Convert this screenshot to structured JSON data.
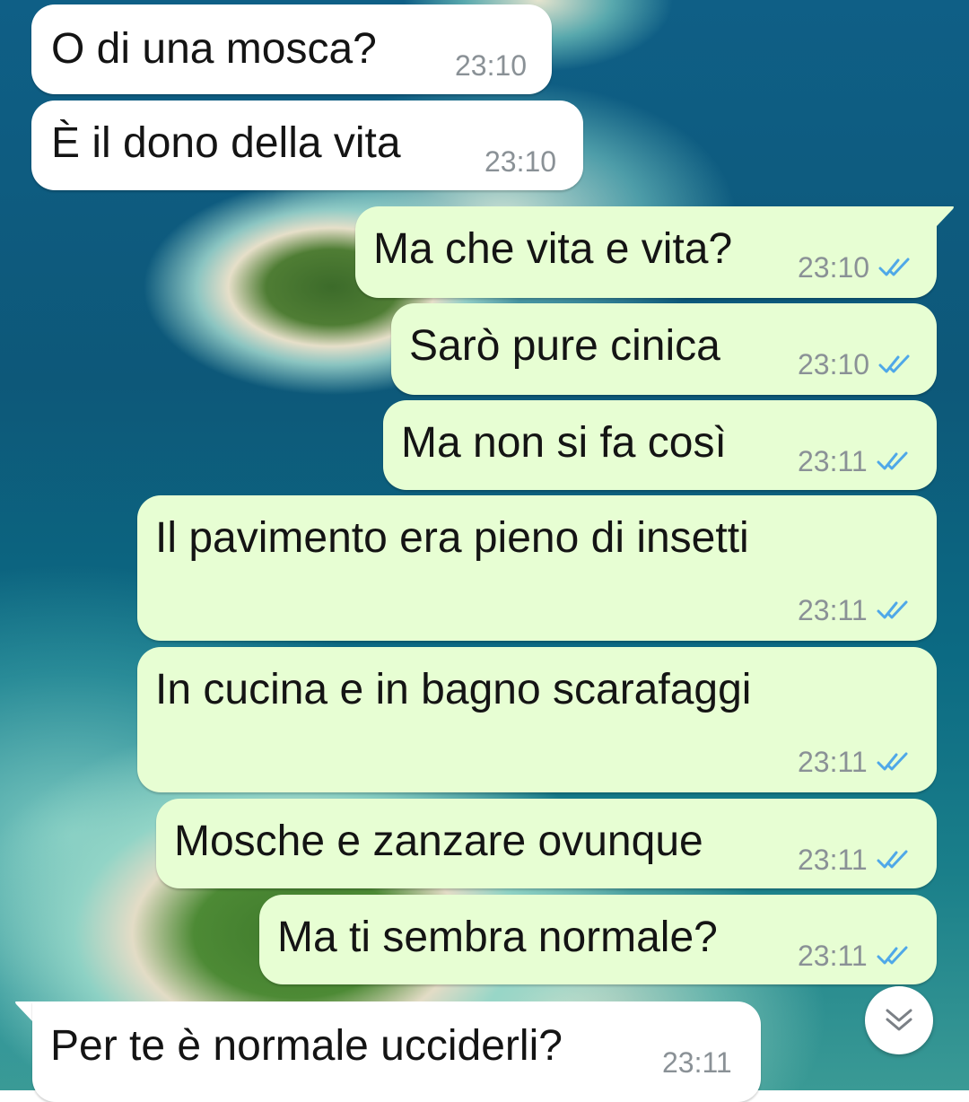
{
  "messages": [
    {
      "direction": "incoming",
      "text": "O di una mosca?",
      "time": "23:10"
    },
    {
      "direction": "incoming",
      "text": "È il dono della vita",
      "time": "23:10"
    },
    {
      "direction": "outgoing",
      "text": "Ma che vita e vita?",
      "time": "23:10",
      "status": "read"
    },
    {
      "direction": "outgoing",
      "text": "Sarò pure cinica",
      "time": "23:10",
      "status": "read"
    },
    {
      "direction": "outgoing",
      "text": "Ma non si fa così",
      "time": "23:11",
      "status": "read"
    },
    {
      "direction": "outgoing",
      "text": "Il pavimento era pieno di insetti",
      "time": "23:11",
      "status": "read"
    },
    {
      "direction": "outgoing",
      "text": "In cucina e in bagno scarafaggi",
      "time": "23:11",
      "status": "read"
    },
    {
      "direction": "outgoing",
      "text": "Mosche e zanzare ovunque",
      "time": "23:11",
      "status": "read"
    },
    {
      "direction": "outgoing",
      "text": "Ma ti sembra normale?",
      "time": "23:11",
      "status": "read"
    },
    {
      "direction": "incoming",
      "text": "Per te è normale ucciderli?",
      "time": "23:11"
    }
  ],
  "colors": {
    "incoming_bubble": "#ffffff",
    "outgoing_bubble": "#e7fed3",
    "read_tick": "#4fa8e8",
    "timestamp": "#8a9196"
  },
  "icons": {
    "read_receipt": "double-check-icon",
    "scroll_down": "chevron-double-down-icon"
  }
}
